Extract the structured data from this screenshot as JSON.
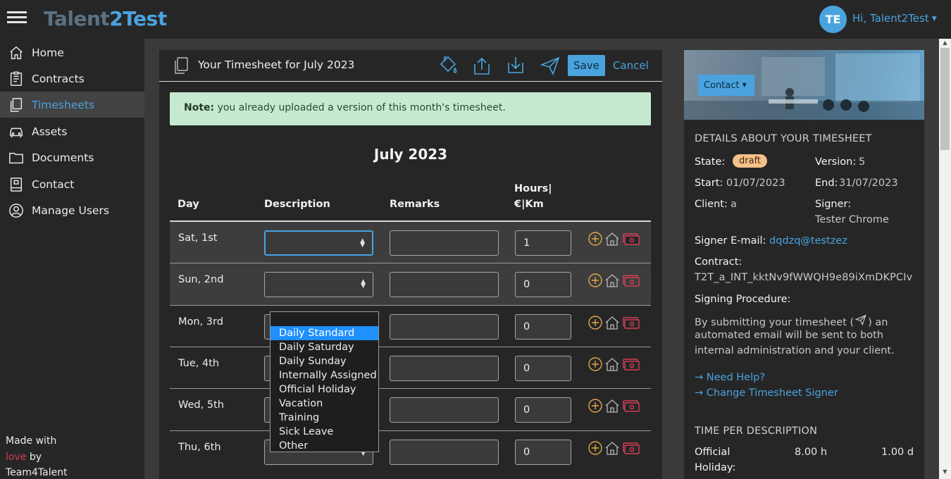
{
  "brand": {
    "logo_a": "Talent",
    "logo_b": "2Test"
  },
  "user": {
    "initials": "TE",
    "greeting": "Hi, Talent2Test"
  },
  "sidebar": {
    "items": [
      {
        "label": "Home",
        "icon": "home-icon"
      },
      {
        "label": "Contracts",
        "icon": "contract-icon"
      },
      {
        "label": "Timesheets",
        "icon": "timesheet-icon",
        "active": true
      },
      {
        "label": "Assets",
        "icon": "car-icon"
      },
      {
        "label": "Documents",
        "icon": "folder-icon"
      },
      {
        "label": "Contact",
        "icon": "book-icon"
      },
      {
        "label": "Manage Users",
        "icon": "users-icon"
      }
    ],
    "footer": {
      "made_with": "Made with",
      "love": "love",
      "by": "by",
      "team": "Team4Talent"
    }
  },
  "timesheet": {
    "title": "Your Timesheet for July 2023",
    "save_label": "Save",
    "cancel_label": "Cancel",
    "note_strong": "Note:",
    "note_text": " you already uploaded a version of this month's timesheet.",
    "month": "July 2023",
    "columns": {
      "day": "Day",
      "description": "Description",
      "remarks": "Remarks",
      "hours_line1": "Hours|",
      "hours_line2": "€|Km"
    },
    "rows": [
      {
        "day": "Sat, 1st",
        "hours": "1"
      },
      {
        "day": "Sun, 2nd",
        "hours": "0"
      },
      {
        "day": "Mon, 3rd",
        "hours": "0"
      },
      {
        "day": "Tue, 4th",
        "hours": "0"
      },
      {
        "day": "Wed, 5th",
        "hours": "0"
      },
      {
        "day": "Thu, 6th",
        "hours": "0"
      }
    ],
    "dropdown_options": [
      "Daily Standard",
      "Daily Saturday",
      "Daily Sunday",
      "Internally Assigned",
      "Official Holiday",
      "Vacation",
      "Training",
      "Sick Leave",
      "Other"
    ],
    "highlighted_option": "Daily Standard"
  },
  "details": {
    "contact_label": "Contact",
    "heading": "DETAILS ABOUT YOUR TIMESHEET",
    "state_label": "State:",
    "state_value": "draft",
    "version_label": "Version:",
    "version_value": "5",
    "start_label": "Start:",
    "start_value": "01/07/2023",
    "end_label": "End:",
    "end_value": "31/07/2023",
    "client_label": "Client:",
    "client_value": "a",
    "signer_label": "Signer:",
    "signer_value": "Tester Chrome",
    "signer_email_label": "Signer E-mail:",
    "signer_email_value": "dqdzq@testzez",
    "contract_label": "Contract:",
    "contract_value": "T2T_a_INT_kktNv9fWWQH9e89iXmDKPCIv",
    "procedure_label": "Signing Procedure:",
    "procedure_line1a": "By submitting your timesheet (",
    "procedure_line1b": ") an",
    "procedure_line2": "automated email will be sent to both",
    "procedure_line3": "internal administration and your client.",
    "help_link": "→ Need Help?",
    "change_signer_link": "→ Change Timesheet Signer",
    "time_heading": "TIME PER DESCRIPTION",
    "time_rows": [
      {
        "label_line1": "Official",
        "label_line2": "Holiday:",
        "hours": "8.00 h",
        "days": "1.00 d"
      }
    ]
  },
  "colors": {
    "accent": "#4aa3df",
    "note_bg": "#c6e9d0",
    "badge": "#f6c08a",
    "icon_orange": "#e0a84a",
    "icon_red": "#d33f56"
  }
}
